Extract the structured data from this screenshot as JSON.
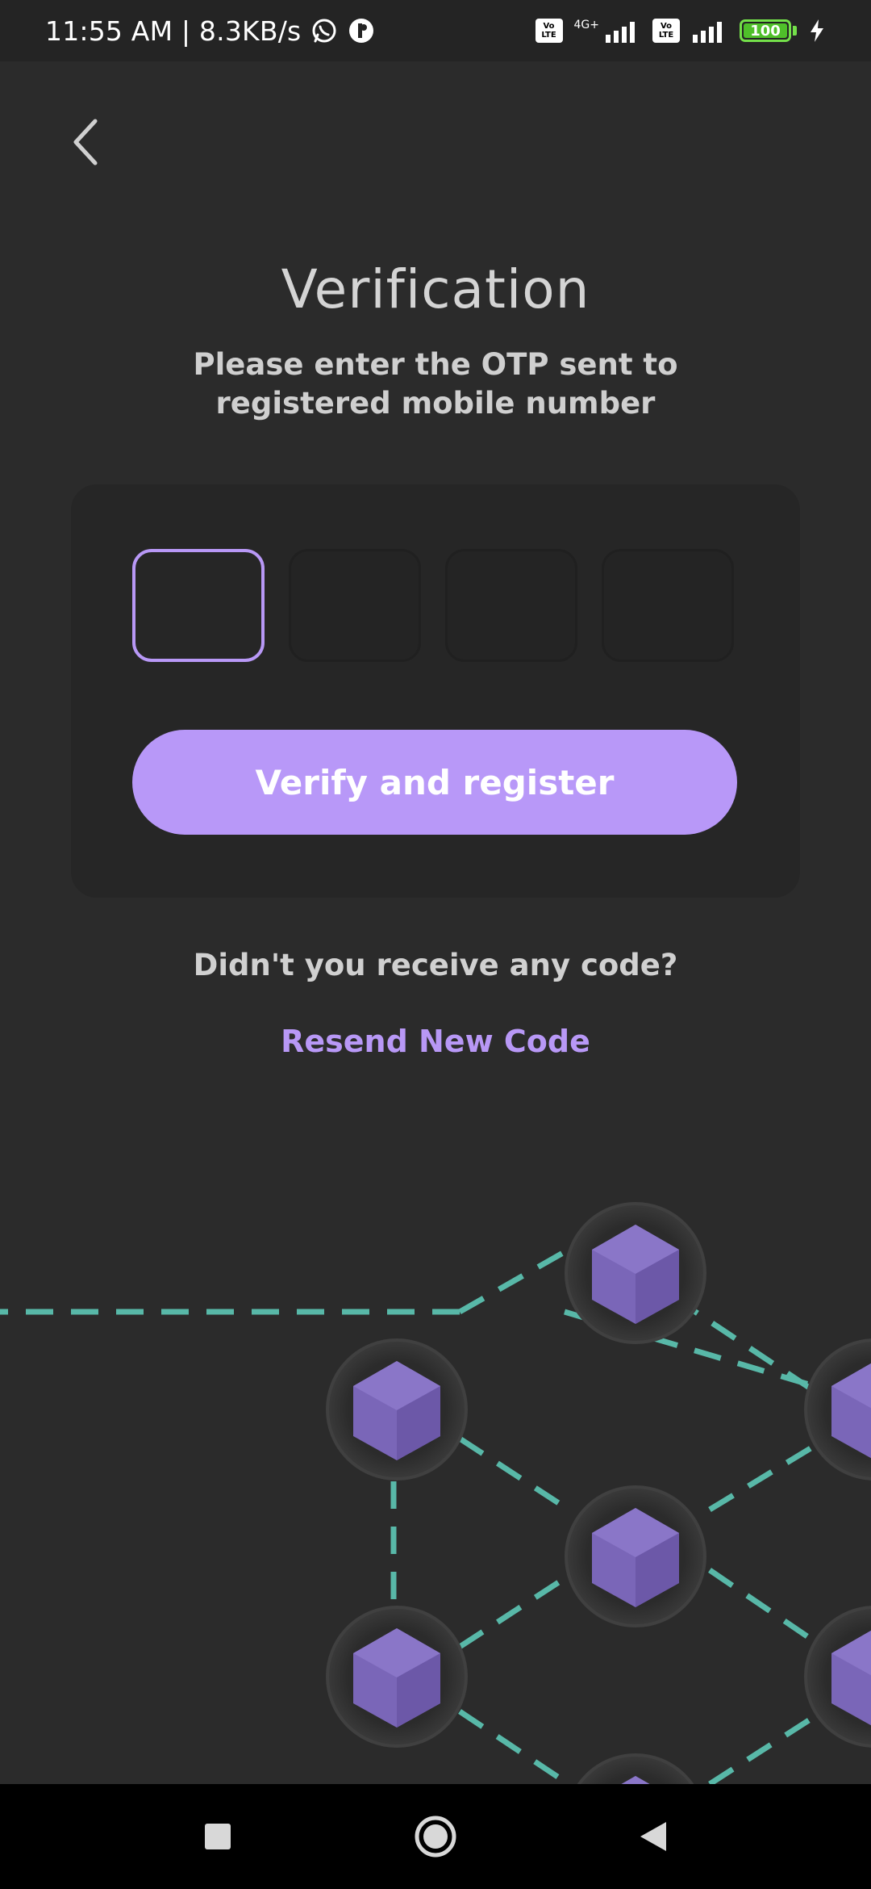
{
  "status_bar": {
    "time_speed": "11:55 AM | 8.3KB/s",
    "volte_label": "Vo\nLTE",
    "network_label": "4G+",
    "battery_level": "100"
  },
  "header": {
    "title": "Verification",
    "subtitle": "Please enter the OTP sent to registered mobile number"
  },
  "otp": {
    "digits": [
      "",
      "",
      "",
      ""
    ]
  },
  "actions": {
    "verify_label": "Verify and register",
    "no_code_text": "Didn't you receive any code?",
    "resend_label": "Resend New Code"
  },
  "colors": {
    "accent": "#b898f6",
    "background": "#2b2b2b",
    "card": "#262626",
    "network_line": "#58b8a8",
    "cube": "#7a66b8"
  }
}
